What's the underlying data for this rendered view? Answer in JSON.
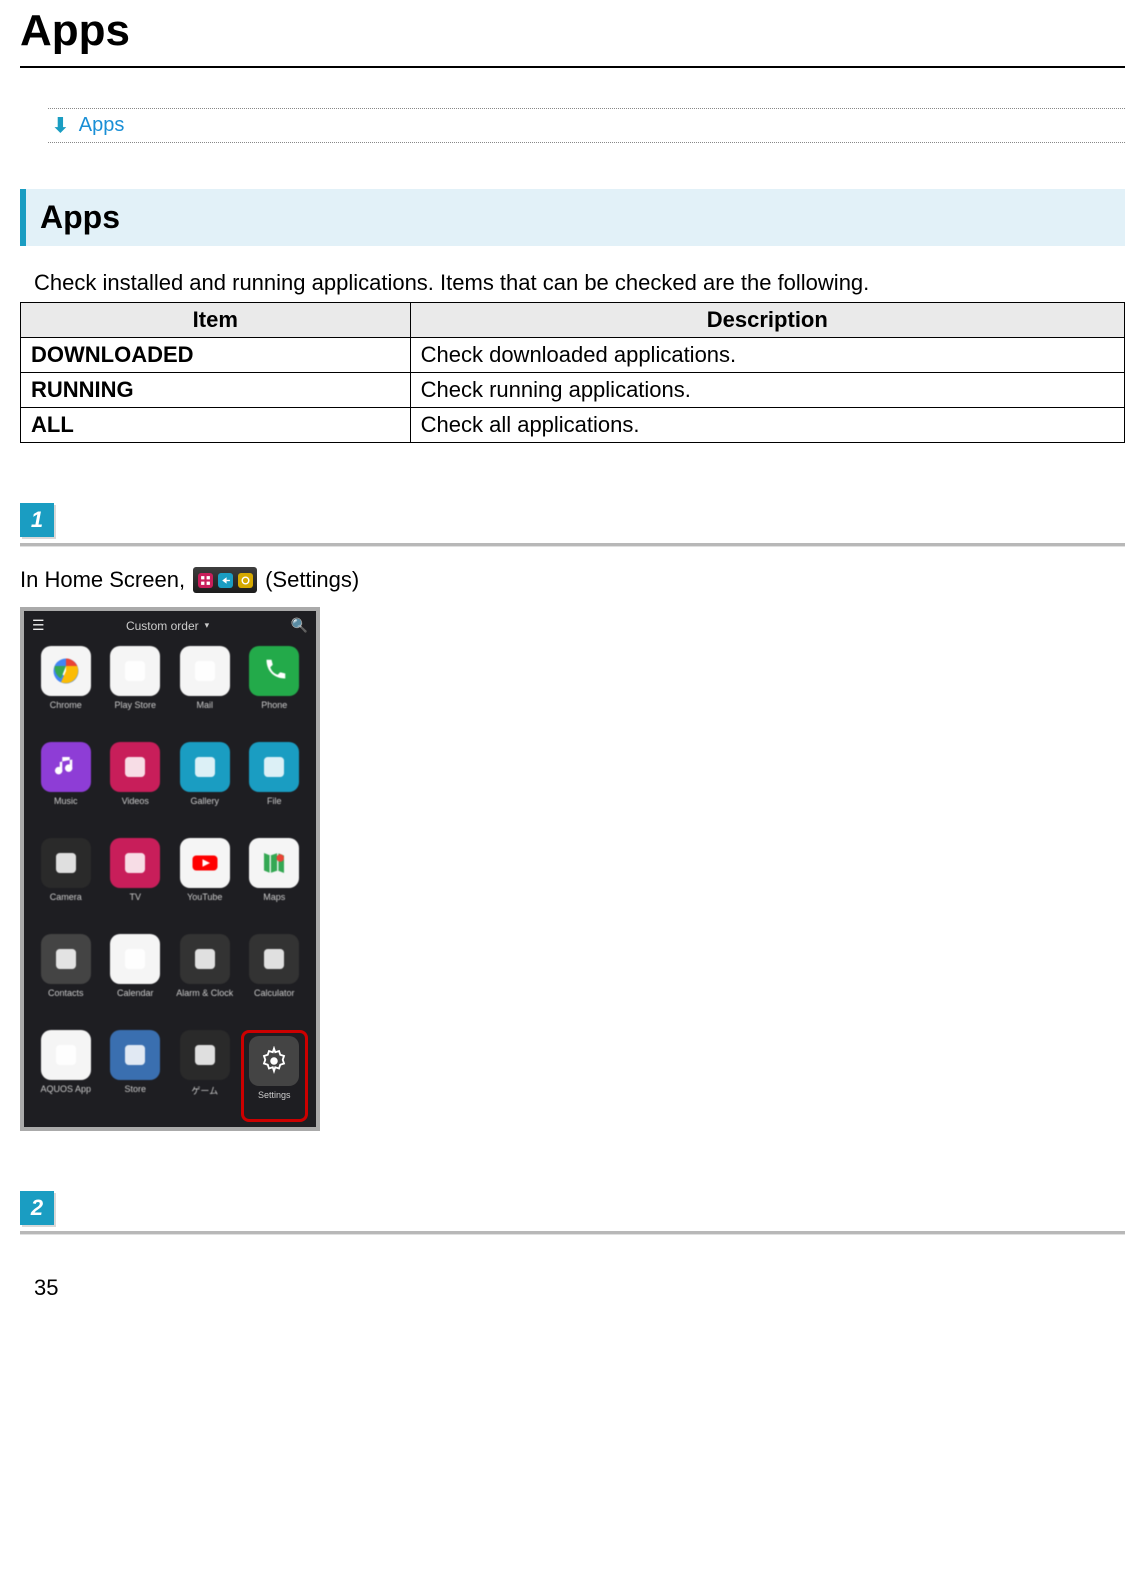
{
  "page_title": "Apps",
  "toc": {
    "link_text": "Apps"
  },
  "section": {
    "heading": "Apps",
    "intro": "Check installed and running applications. Items that can be checked are the following."
  },
  "table": {
    "headers": {
      "item": "Item",
      "description": "Description"
    },
    "rows": [
      {
        "item": "DOWNLOADED",
        "description": "Check downloaded applications."
      },
      {
        "item": "RUNNING",
        "description": "Check running applications."
      },
      {
        "item": "ALL",
        "description": "Check all applications."
      }
    ]
  },
  "steps": {
    "step1": {
      "badge": "1",
      "text_before": "In Home Screen,",
      "text_after": "(Settings)"
    },
    "step2": {
      "badge": "2"
    }
  },
  "phone": {
    "top_label": "Custom order",
    "dots": "•  •  •",
    "apps": [
      {
        "label": "Chrome",
        "bg": "#f5f5f5"
      },
      {
        "label": "Play Store",
        "bg": "#f5f5f5"
      },
      {
        "label": "Mail",
        "bg": "#f5f5f5"
      },
      {
        "label": "Phone",
        "bg": "#23aa4a"
      },
      {
        "label": "Music",
        "bg": "#8e3dd6"
      },
      {
        "label": "Videos",
        "bg": "#c81e5a"
      },
      {
        "label": "Gallery",
        "bg": "#1a9dc2"
      },
      {
        "label": "File",
        "bg": "#1a9dc2"
      },
      {
        "label": "Camera",
        "bg": "#2a2a2a"
      },
      {
        "label": "TV",
        "bg": "#c81e5a"
      },
      {
        "label": "YouTube",
        "bg": "#f5f5f5"
      },
      {
        "label": "Maps",
        "bg": "#f5f5f5"
      },
      {
        "label": "Contacts",
        "bg": "#444"
      },
      {
        "label": "Calendar",
        "bg": "#f5f5f5"
      },
      {
        "label": "Alarm & Clock",
        "bg": "#333"
      },
      {
        "label": "Calculator",
        "bg": "#333"
      },
      {
        "label": "AQUOS App",
        "bg": "#f5f5f5"
      },
      {
        "label": "Store",
        "bg": "#3a6fb0"
      },
      {
        "label": "ゲーム",
        "bg": "#2a2a2a"
      },
      {
        "label": "Settings",
        "bg": "#444",
        "selected": true
      }
    ]
  },
  "page_number": "35"
}
